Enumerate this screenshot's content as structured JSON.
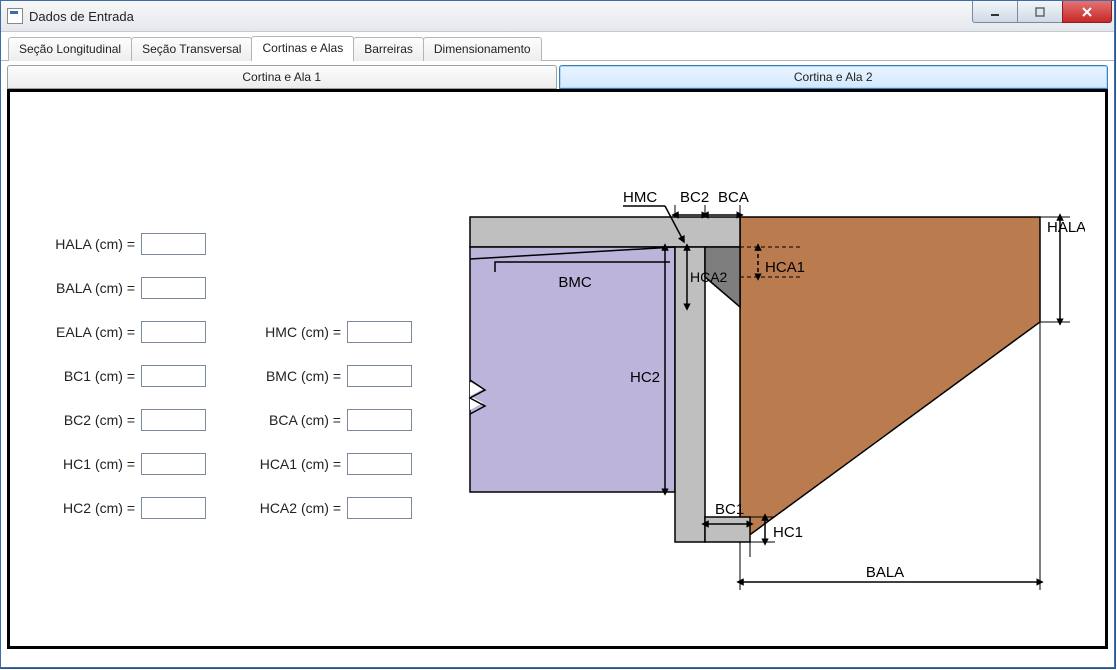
{
  "window": {
    "title": "Dados de Entrada"
  },
  "tabs": [
    {
      "label": "Seção Longitudinal"
    },
    {
      "label": "Seção Transversal"
    },
    {
      "label": "Cortinas e Alas"
    },
    {
      "label": "Barreiras"
    },
    {
      "label": "Dimensionamento"
    }
  ],
  "subtabs": [
    {
      "label": "Cortina e Ala 1"
    },
    {
      "label": "Cortina e Ala 2"
    }
  ],
  "fields": {
    "col1": [
      {
        "label": "HALA (cm) =",
        "value": ""
      },
      {
        "label": "BALA (cm) =",
        "value": ""
      },
      {
        "label": "EALA (cm) =",
        "value": ""
      },
      {
        "label": "BC1 (cm) =",
        "value": ""
      },
      {
        "label": "BC2 (cm) =",
        "value": ""
      },
      {
        "label": "HC1 (cm) =",
        "value": ""
      },
      {
        "label": "HC2 (cm) =",
        "value": ""
      }
    ],
    "col2": [
      {
        "label": "HMC (cm) =",
        "value": ""
      },
      {
        "label": "BMC (cm) =",
        "value": ""
      },
      {
        "label": "BCA (cm) =",
        "value": ""
      },
      {
        "label": "HCA1 (cm) =",
        "value": ""
      },
      {
        "label": "HCA2 (cm) =",
        "value": ""
      }
    ]
  },
  "diagram_labels": {
    "HMC": "HMC",
    "BC2": "BC2",
    "BCA": "BCA",
    "BMC": "BMC",
    "HCA1": "HCA1",
    "HCA2": "HCA2",
    "HC2": "HC2",
    "BC1": "BC1",
    "HC1": "HC1",
    "BALA": "BALA",
    "HALA": "HALA"
  },
  "colors": {
    "purple": "#bdb4db",
    "brown": "#ba7b4f",
    "grey": "#bfbfbf",
    "darkgrey": "#7e7e7e"
  }
}
